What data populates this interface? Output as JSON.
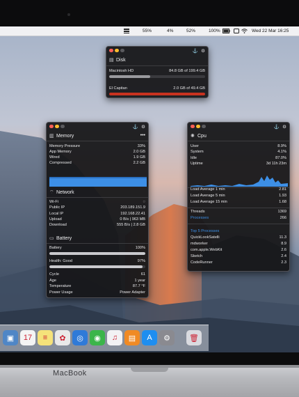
{
  "device": {
    "brand": "MacBook"
  },
  "menubar": {
    "items": [
      "55%",
      "4%",
      "52%",
      "100%"
    ],
    "datetime": "Wed 22 Mar 16:25"
  },
  "colors": {
    "blue": "#3d8fe6",
    "red": "#c8321f",
    "gray": "#9a9a9e",
    "panel_bg": "#161618"
  },
  "disk": {
    "title": "Disk",
    "volumes": [
      {
        "name": "Macintosh HD",
        "value": "84.8 GB of 199.4 GB",
        "used_fraction": 0.43,
        "color": "gray"
      },
      {
        "name": "El Capitan",
        "value": "2.0 GB of 49.4 GB",
        "used_fraction": 1.0,
        "color": "red"
      }
    ]
  },
  "memory": {
    "title": "Memory",
    "more": "•••",
    "rows": [
      {
        "k": "Memory Pressure",
        "v": "33%"
      },
      {
        "k": "App Memory",
        "v": "2.0 GB"
      },
      {
        "k": "Wired",
        "v": "1.9 GB"
      },
      {
        "k": "Compressed",
        "v": "2.2 GB"
      }
    ]
  },
  "network": {
    "title": "Network",
    "rows": [
      {
        "k": "Wi-Fi",
        "v": "◌"
      },
      {
        "k": "Public IP",
        "v": "203.189.151.9"
      },
      {
        "k": "Local IP",
        "v": "192.168.22.41"
      },
      {
        "k": "Upload",
        "v": "0 B/s | 963 MB"
      },
      {
        "k": "Download",
        "v": "555 B/s | 2.8 GB"
      }
    ]
  },
  "battery": {
    "title": "Battery",
    "level_label": "Battery",
    "level_value": "100%",
    "level_fraction": 1.0,
    "health_label": "Health: Good",
    "health_value": "97%",
    "health_fraction": 0.97,
    "rows": [
      {
        "k": "Cycle",
        "v": "61"
      },
      {
        "k": "Age",
        "v": "1 year"
      },
      {
        "k": "Temperature",
        "v": "87.7 °F"
      },
      {
        "k": "Power Usage",
        "v": "Power Adapter"
      }
    ]
  },
  "cpu": {
    "title": "Cpu",
    "rows": [
      {
        "k": "User",
        "v": "8.9%"
      },
      {
        "k": "System",
        "v": "4.1%"
      },
      {
        "k": "Idle",
        "v": "87.0%"
      },
      {
        "k": "Uptime",
        "v": "3d 11h 23m"
      }
    ],
    "load": [
      {
        "k": "Load Average 1 min",
        "v": "2.81"
      },
      {
        "k": "Load Average 5 min",
        "v": "1.93"
      },
      {
        "k": "Load Average 15 min",
        "v": "1.68"
      }
    ],
    "counts": [
      {
        "k": "Threads",
        "v": "1369"
      },
      {
        "k": "Processes",
        "v": "266"
      }
    ],
    "top_title": "Top 5 Processes",
    "top": [
      {
        "k": "QuickLookSatelli",
        "v": "11.3"
      },
      {
        "k": "mdworker",
        "v": "8.9"
      },
      {
        "k": "com.apple.WebKit",
        "v": "2.6"
      },
      {
        "k": "Sketch",
        "v": "2.4"
      },
      {
        "k": "CodeRunner",
        "v": "2.3"
      }
    ]
  },
  "dock": {
    "apps": [
      {
        "name": "preview-icon",
        "color": "#4f86c6",
        "glyph": "▣"
      },
      {
        "name": "calendar-icon",
        "color": "#f4f4f4",
        "glyph": "17"
      },
      {
        "name": "notes-icon",
        "color": "#f5e27a",
        "glyph": "≡"
      },
      {
        "name": "photos-icon",
        "color": "#e9e9e9",
        "glyph": "✿"
      },
      {
        "name": "safari-icon",
        "color": "#2f7ad8",
        "glyph": "◎"
      },
      {
        "name": "facetime-icon",
        "color": "#3bb54a",
        "glyph": "◉"
      },
      {
        "name": "itunes-icon",
        "color": "#f2f2f4",
        "glyph": "♫"
      },
      {
        "name": "ibooks-icon",
        "color": "#f08a24",
        "glyph": "▤"
      },
      {
        "name": "app-store-icon",
        "color": "#1e8ef0",
        "glyph": "A"
      },
      {
        "name": "system-preferences-icon",
        "color": "#8a8a90",
        "glyph": "⚙"
      },
      {
        "name": "trash-icon",
        "color": "#d9dadf",
        "glyph": "🗑"
      }
    ]
  }
}
